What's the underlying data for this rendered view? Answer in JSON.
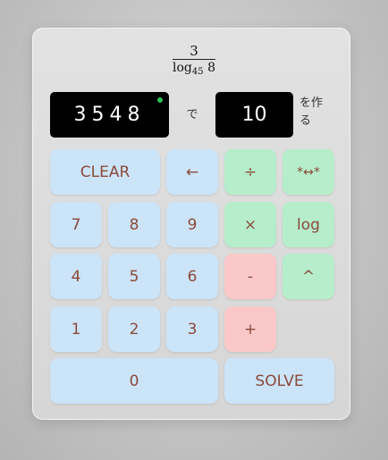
{
  "formula": {
    "numerator": "3",
    "log": "log",
    "base": "45",
    "argument": "8"
  },
  "digits_display": "3548",
  "connector_text": "で",
  "target_display": "10",
  "suffix_text": "を作る",
  "buttons": {
    "clear": "CLEAR",
    "backspace": "←",
    "divide": "÷",
    "swap": "*↔*",
    "seven": "7",
    "eight": "8",
    "nine": "9",
    "multiply": "×",
    "log": "log",
    "four": "4",
    "five": "5",
    "six": "6",
    "minus": "-",
    "power": "^",
    "one": "1",
    "two": "2",
    "three": "3",
    "plus": "+",
    "zero": "0",
    "solve": "SOLVE"
  },
  "colors": {
    "number_key": "#cce4f8",
    "operator_key": "#b6eecb",
    "arith_key": "#fac8c8",
    "key_text": "#8a4a3a",
    "status_dot": "#2ec05a"
  }
}
